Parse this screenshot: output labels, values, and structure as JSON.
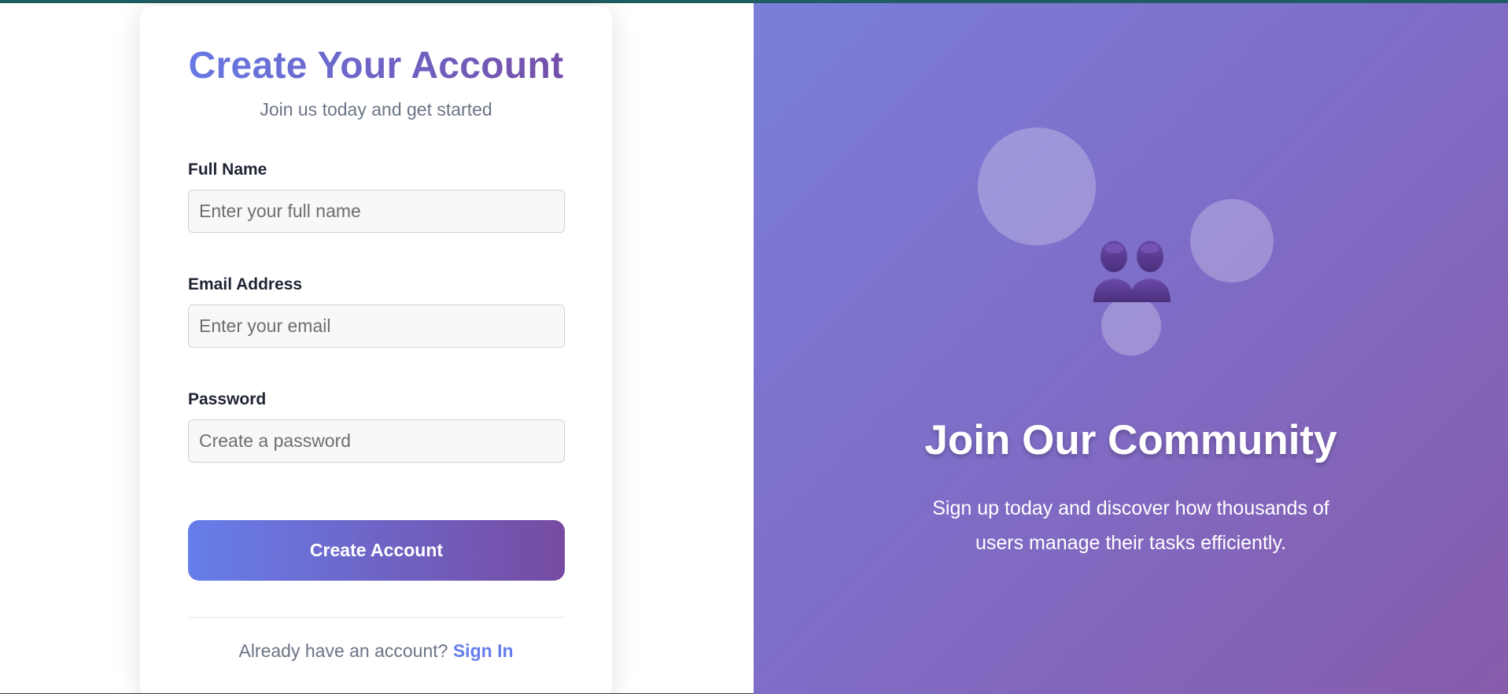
{
  "form": {
    "title": "Create Your Account",
    "subtitle": "Join us today and get started",
    "fields": [
      {
        "label": "Full Name",
        "placeholder": "Enter your full name",
        "value": ""
      },
      {
        "label": "Email Address",
        "placeholder": "Enter your email",
        "value": ""
      },
      {
        "label": "Password",
        "placeholder": "Create a password",
        "value": ""
      }
    ],
    "submit_label": "Create Account",
    "footer_prompt": "Already have an account?",
    "footer_link": "Sign In"
  },
  "hero": {
    "icon": "people-icon",
    "title": "Join Our Community",
    "text": "Sign up today and discover how thousands of users manage their tasks efficiently."
  },
  "colors": {
    "accent_start": "#667eea",
    "accent_end": "#764ba2",
    "top_strip": "#1f5c63"
  }
}
